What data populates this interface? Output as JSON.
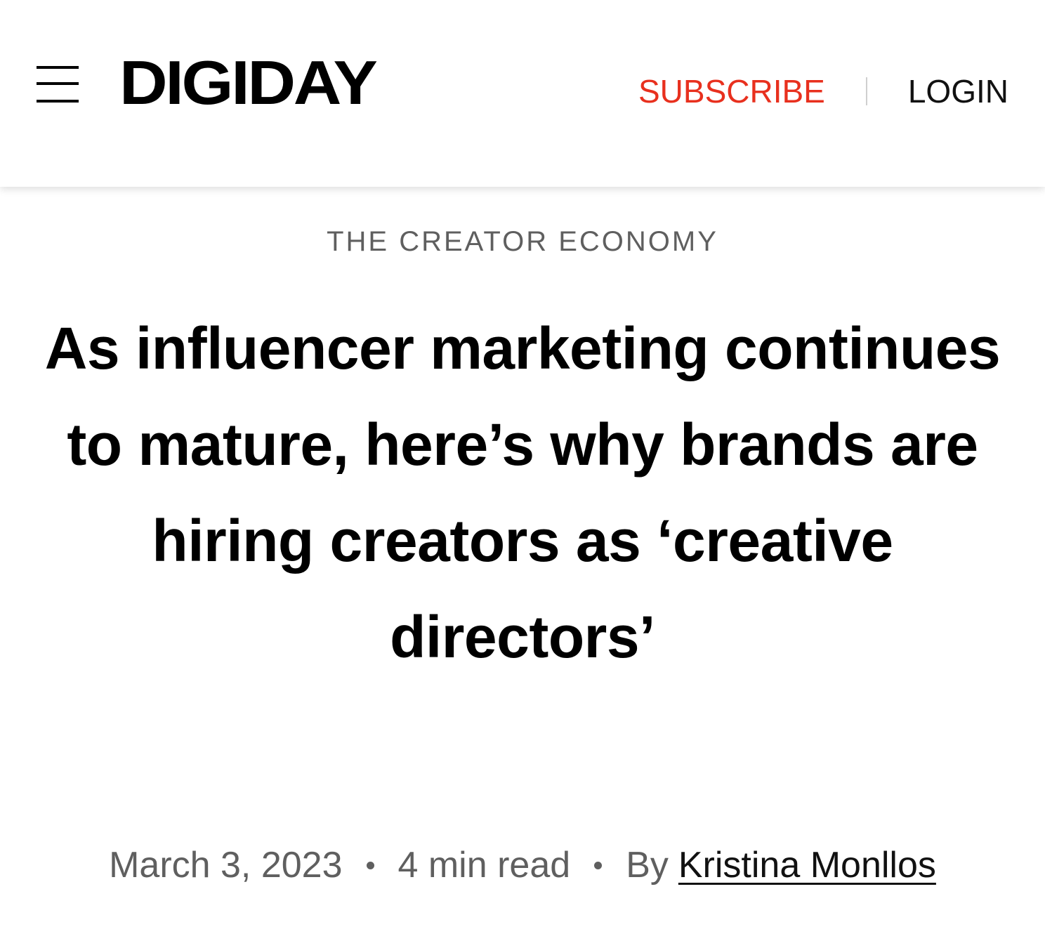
{
  "header": {
    "menu_icon": "hamburger-menu-icon",
    "logo": "DIGIDAY",
    "subscribe_label": "SUBSCRIBE",
    "login_label": "LOGIN",
    "accent_color": "#e8301e"
  },
  "article": {
    "category": "THE CREATOR ECONOMY",
    "headline": "As influencer marketing continues to mature, here’s why brands are hiring creators as ‘creative directors’",
    "date": "March 3, 2023",
    "read_time": "4 min read",
    "by_label": "By",
    "author": "Kristina Monllos"
  }
}
